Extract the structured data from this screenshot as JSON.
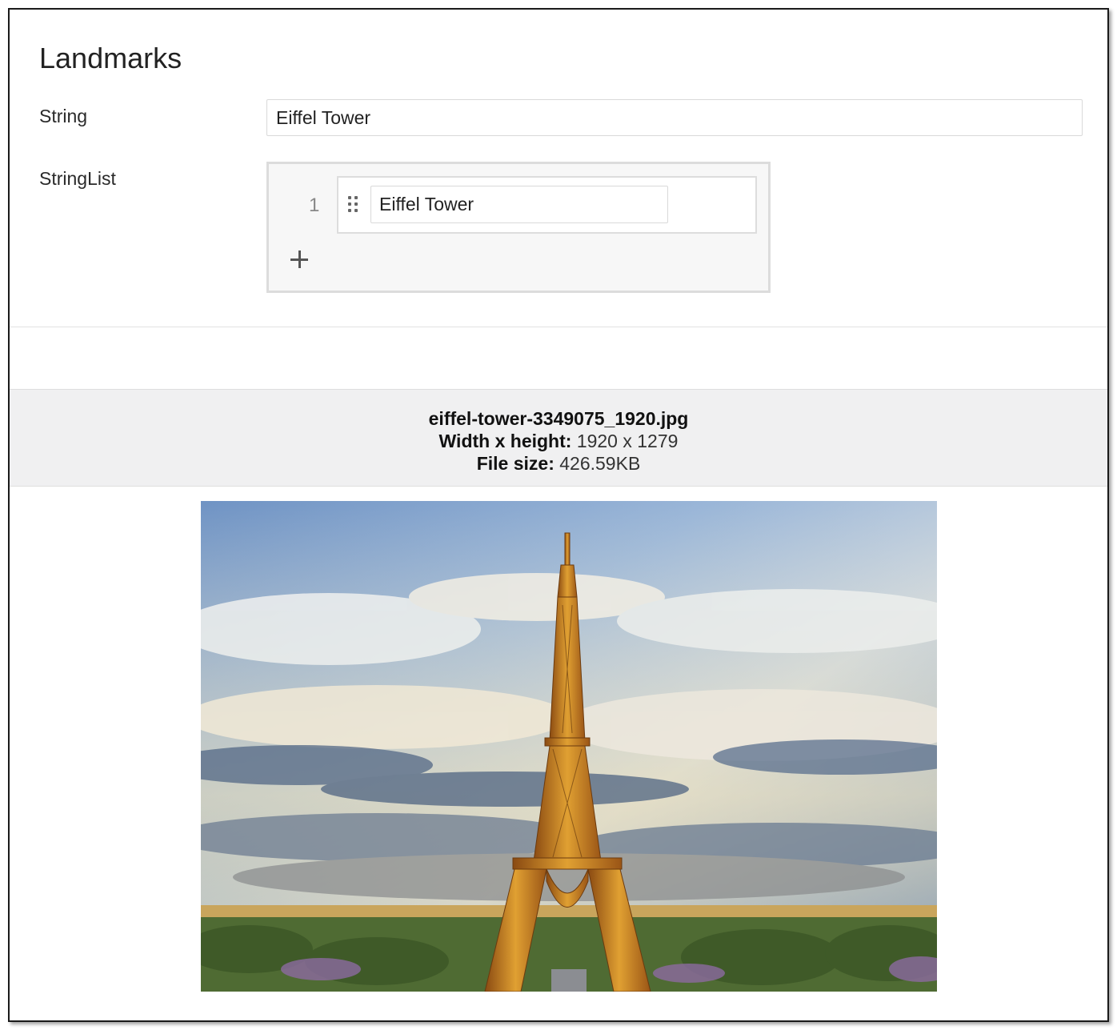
{
  "form": {
    "title": "Landmarks",
    "string_label": "String",
    "string_value": "Eiffel Tower",
    "stringlist_label": "StringList",
    "stringlist_items": [
      {
        "index": "1",
        "value": "Eiffel Tower"
      }
    ]
  },
  "file_info": {
    "filename": "eiffel-tower-3349075_1920.jpg",
    "dimensions_label": "Width x height:",
    "dimensions_value": "1920 x 1279",
    "size_label": "File size:",
    "size_value": "426.59KB"
  },
  "icons": {
    "drag": "drag-handle-icon",
    "add": "plus-icon"
  },
  "colors": {
    "info_band_bg": "#f0f0f1",
    "list_bg": "#f7f7f7",
    "border": "#dcdcdc"
  }
}
